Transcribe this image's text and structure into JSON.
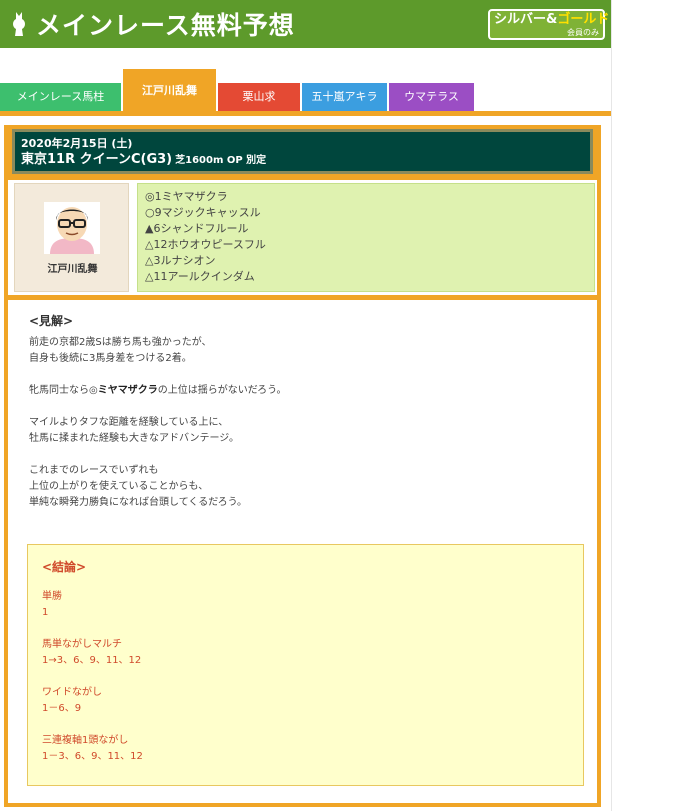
{
  "header": {
    "title": "メインレース無料予想",
    "badge_silver": "シルバー&",
    "badge_gold": "ゴールド",
    "badge_sub": "会員のみ"
  },
  "tabs": [
    {
      "label": "メインレース馬柱",
      "color": "#3dbf6e"
    },
    {
      "label": "江戸川乱舞",
      "color": "#f0a526",
      "active": true
    },
    {
      "label": "栗山求",
      "color": "#e44a34"
    },
    {
      "label": "五十嵐アキラ",
      "color": "#3b9ee0"
    },
    {
      "label": "ウマテラス",
      "color": "#9b4ec4"
    }
  ],
  "race": {
    "date": "2020年2月15日 (土)",
    "name": "東京11R クイーンC(G3)",
    "condition": "芝1600m OP 別定"
  },
  "tipster": {
    "name": "江戸川乱舞",
    "icon": "tipster-avatar-icon"
  },
  "picks": [
    "◎1ミヤマザクラ",
    "○9マジックキャッスル",
    "▲6シャンドフルール",
    "△12ホウオウピースフル",
    "△3ルナシオン",
    "△11アールクインダム"
  ],
  "analysis": {
    "heading": "<見解>",
    "p1_l1": "前走の京都2歳Sは勝ち馬も強かったが、",
    "p1_l2": "自身も後続に3馬身差をつける2着。",
    "p2_pre": "牝馬同士なら◎",
    "p2_bold": "ミヤマザクラ",
    "p2_post": "の上位は揺らがないだろう。",
    "p3_l1": "マイルよりタフな距離を経験している上に、",
    "p3_l2": "牡馬に揉まれた経験も大きなアドバンテージ。",
    "p4_l1": "これまでのレースでいずれも",
    "p4_l2": "上位の上がりを使えていることからも、",
    "p4_l3": "単純な瞬発力勝負になれば台頭してくるだろう。"
  },
  "conclusion": {
    "heading": "<結論>",
    "bets": [
      {
        "type": "単勝",
        "value": "1"
      },
      {
        "type": "馬単ながしマルチ",
        "value": "1→3、6、9、11、12"
      },
      {
        "type": "ワイドながし",
        "value": "1－6、9"
      },
      {
        "type": "三連複軸1頭ながし",
        "value": "1－3、6、9、11、12"
      }
    ]
  }
}
